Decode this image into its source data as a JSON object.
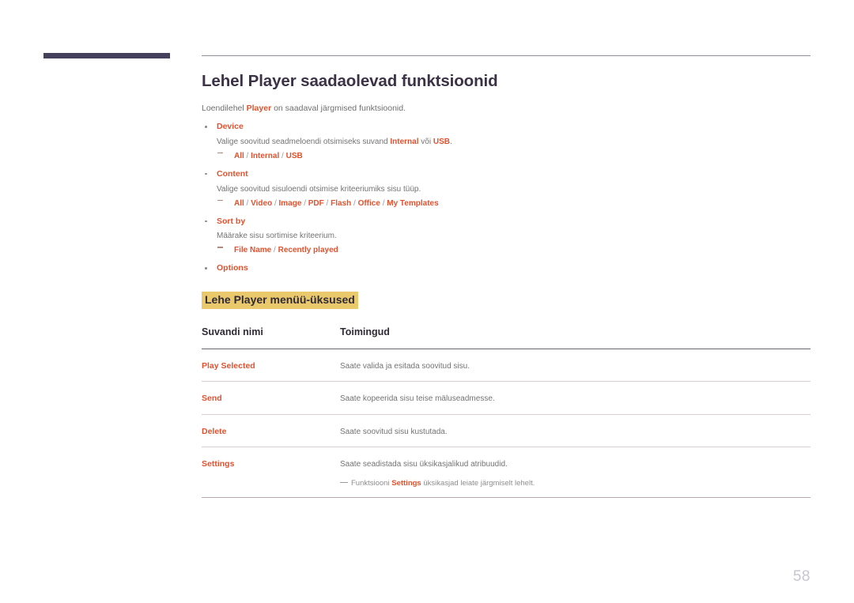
{
  "page": {
    "number": "58",
    "title": "Lehel Player saadaolevad funktsioonid",
    "intro_before": "Loendilehel ",
    "intro_keyword": "Player",
    "intro_after": " on saadaval järgmised funktsioonid."
  },
  "colors": {
    "accent_orange": "#e0522f",
    "heading_purple": "#3b3246",
    "highlight_gold": "#e9c96c",
    "body_gray": "#737376",
    "corner_bar": "#45415c"
  },
  "bullets": [
    {
      "label": "Device",
      "description": {
        "before": "Valige soovitud seadmeloendi otsimiseks suvand ",
        "kw1": "Internal",
        "middle": " või ",
        "kw2": "USB",
        "after": "."
      },
      "options": [
        {
          "text": "All",
          "highlight": true
        },
        {
          "text": " / ",
          "highlight": false
        },
        {
          "text": "Internal",
          "highlight": true
        },
        {
          "text": " / ",
          "highlight": false
        },
        {
          "text": "USB",
          "highlight": true
        }
      ]
    },
    {
      "label": "Content",
      "description": {
        "before": "Valige soovitud sisuloendi otsimise kriteeriumiks sisu tüüp.",
        "kw1": "",
        "middle": "",
        "kw2": "",
        "after": ""
      },
      "options": [
        {
          "text": "All",
          "highlight": true
        },
        {
          "text": " / ",
          "highlight": false
        },
        {
          "text": "Video",
          "highlight": true
        },
        {
          "text": " / ",
          "highlight": false
        },
        {
          "text": "Image",
          "highlight": true
        },
        {
          "text": " / ",
          "highlight": false
        },
        {
          "text": "PDF",
          "highlight": true
        },
        {
          "text": " / ",
          "highlight": false
        },
        {
          "text": "Flash",
          "highlight": true
        },
        {
          "text": " / ",
          "highlight": false
        },
        {
          "text": "Office",
          "highlight": true
        },
        {
          "text": " / ",
          "highlight": false
        },
        {
          "text": "My Templates",
          "highlight": true
        }
      ]
    },
    {
      "label": "Sort by",
      "description": {
        "before": "Määrake sisu sortimise kriteerium.",
        "kw1": "",
        "middle": "",
        "kw2": "",
        "after": ""
      },
      "options": [
        {
          "text": "File Name",
          "highlight": true
        },
        {
          "text": " / ",
          "highlight": false
        },
        {
          "text": "Recently played",
          "highlight": true
        }
      ]
    },
    {
      "label": "Options",
      "description": null,
      "options": []
    }
  ],
  "subheading": "Lehe Player menüü-üksused",
  "table": {
    "headers": [
      "Suvandi nimi",
      "Toimingud"
    ],
    "rows": [
      {
        "name": "Play Selected",
        "action": "Saate valida ja esitada soovitud sisu.",
        "note": null
      },
      {
        "name": "Send",
        "action": "Saate kopeerida sisu teise mäluseadmesse.",
        "note": null
      },
      {
        "name": "Delete",
        "action": "Saate soovitud sisu kustutada.",
        "note": null
      },
      {
        "name": "Settings",
        "action": "Saate seadistada sisu üksikasjalikud atribuudid.",
        "note": {
          "before": "Funktsiooni ",
          "keyword": "Settings",
          "after": " üksikasjad leiate järgmiselt lehelt."
        }
      }
    ]
  }
}
